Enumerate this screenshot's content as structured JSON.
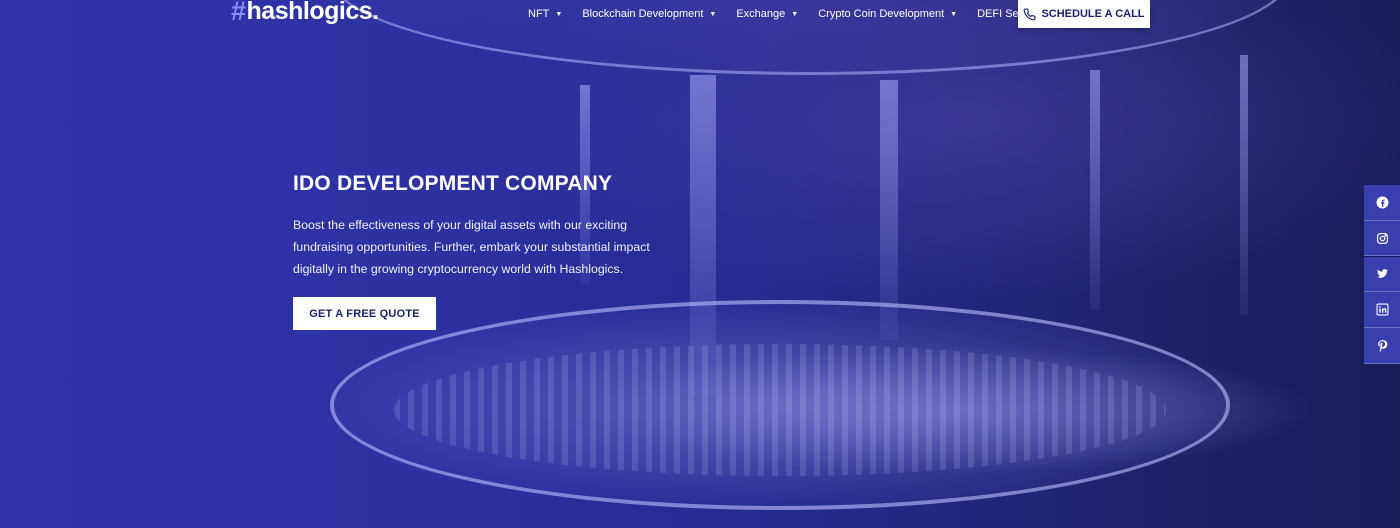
{
  "brand": {
    "logo_text": "hashlogics.",
    "logo_symbol": "#"
  },
  "nav": {
    "items": [
      {
        "label": "NFT"
      },
      {
        "label": "Blockchain Development"
      },
      {
        "label": "Exchange"
      },
      {
        "label": "Crypto Coin Development"
      },
      {
        "label": "DEFI Services"
      }
    ],
    "cta_label": "SCHEDULE A CALL"
  },
  "hero": {
    "title": "IDO DEVELOPMENT COMPANY",
    "description": "Boost the effectiveness of your digital assets with our exciting fundraising opportunities. Further, embark your substantial impact digitally in the growing cryptocurrency world with Hashlogics.",
    "button_label": "GET A FREE QUOTE"
  },
  "social": {
    "icons": [
      "facebook-icon",
      "instagram-icon",
      "twitter-icon",
      "linkedin-icon",
      "pinterest-icon"
    ]
  },
  "colors": {
    "background": "#2b2f9e",
    "button_text": "#1b1f6b",
    "logo_accent": "#8a8cff"
  }
}
